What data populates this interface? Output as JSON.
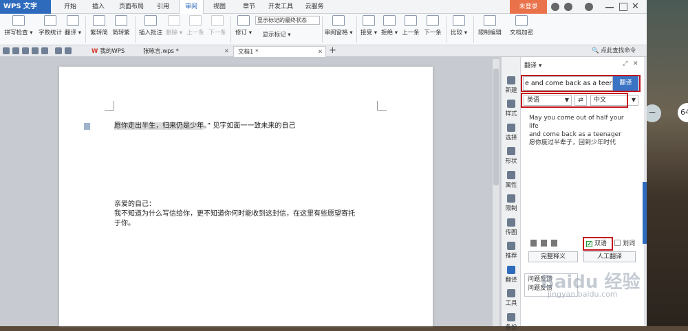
{
  "app": {
    "logo_text": "WPS 文字",
    "login_label": "未登录"
  },
  "menu": [
    "开始",
    "插入",
    "页面布局",
    "引用",
    "审阅",
    "视图",
    "章节",
    "开发工具",
    "云服务"
  ],
  "ribbon": [
    {
      "label": "拼写检查 ▾",
      "icon_text": "ABC"
    },
    {
      "label": "字数统计",
      "icon_text": "123 ABC"
    },
    {
      "label": "翻译 ▾",
      "icon_text": "a中"
    },
    {
      "label": "繁转简"
    },
    {
      "label": "简转繁"
    },
    {
      "label": "插入批注"
    },
    {
      "label": "删除 ▾"
    },
    {
      "label": "上一条"
    },
    {
      "label": "下一条"
    },
    {
      "label": "修订 ▾"
    },
    {
      "label": "显示标记 ▾"
    },
    {
      "label": "审阅窗格 ▾"
    },
    {
      "label": "接受 ▾"
    },
    {
      "label": "拒绝 ▾"
    },
    {
      "label": "上一条"
    },
    {
      "label": "下一条"
    },
    {
      "label": "比较 ▾"
    },
    {
      "label": "限制编辑"
    },
    {
      "label": "文档加密"
    }
  ],
  "markup_dropdown": "显示标记的最终状态",
  "tabs": {
    "mywps": "我的WPS",
    "doc1": "张咏言.wps *",
    "doc2": "文档1 *",
    "add": "+"
  },
  "find_command": "点此查找命令",
  "document": {
    "line1_highlight": "愿你走出半生，归来仍是少年",
    "line1_rest": "。” 见字如面一一致未来的自己",
    "line2": "亲爱的自己：",
    "line3": "我不知道为什么写信给你，更不知道你何时能收到这封信，在这里有些愿望寄托",
    "line4": "于你。"
  },
  "side_tools": [
    "新建",
    "样式",
    "选择",
    "形状",
    "属性",
    "限制",
    "传图",
    "推荐",
    "翻译",
    "工具",
    "备份"
  ],
  "translate": {
    "title": "翻译 ▾",
    "input_value": "e and come back as a teenager",
    "button": "翻译",
    "source_lang": "英语",
    "target_lang": "中文",
    "result_line1": "May you come out of half your life",
    "result_line2": "and come back as a teenager",
    "result_line3": "愿你度过半辈子，回到少年时代",
    "bilingual_label": "双语",
    "hover_label": "划词",
    "full_def_button": "完整释义",
    "human_trans_button": "人工翻译",
    "feedback_line1": "问题反馈",
    "feedback_line2": "问题反馈"
  },
  "desktop": {
    "badge": "64",
    "circle_symbol": "−"
  },
  "watermark": {
    "main": "Baidu 经验",
    "sub": "jingyan.baidu.com"
  }
}
